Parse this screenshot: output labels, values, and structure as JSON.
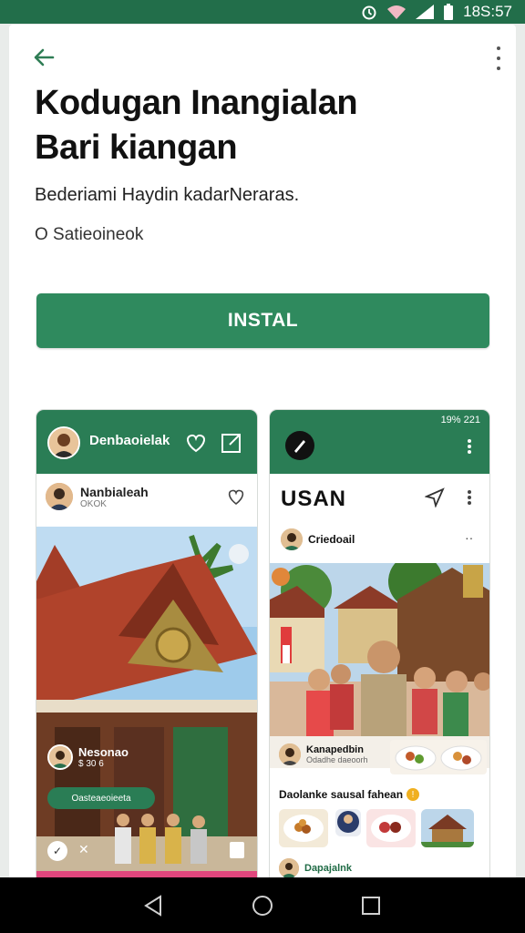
{
  "status": {
    "time": "18S:57"
  },
  "app": {
    "title_line1": "Kodugan Inangialan",
    "title_line2": "Bari kiangan",
    "subtitle": "Bederiami Haydin kadarNeraras.",
    "meta": "O Satieoineok",
    "install_label": "INSTAL"
  },
  "screenshot_left": {
    "header_title": "Denbaoielak",
    "post_author": "Nanbialeah",
    "post_sub": "OKOK",
    "overlay_name": "Nesonao",
    "overlay_sub": "$ 30 6",
    "chip_text": "Oasteaeoieeta"
  },
  "screenshot_right": {
    "status_time": "19% 221",
    "page_title": "USAN",
    "account_name": "Criedoail",
    "caption_name": "Kanapedbin",
    "caption_sub": "Odadhe daeoorh",
    "section_title": "Daolanke sausal fahean",
    "footer_name": "Dapajalnk"
  },
  "colors": {
    "status_bar": "#226e4a",
    "accent": "#2f8a5e",
    "header": "#2a7d55"
  }
}
